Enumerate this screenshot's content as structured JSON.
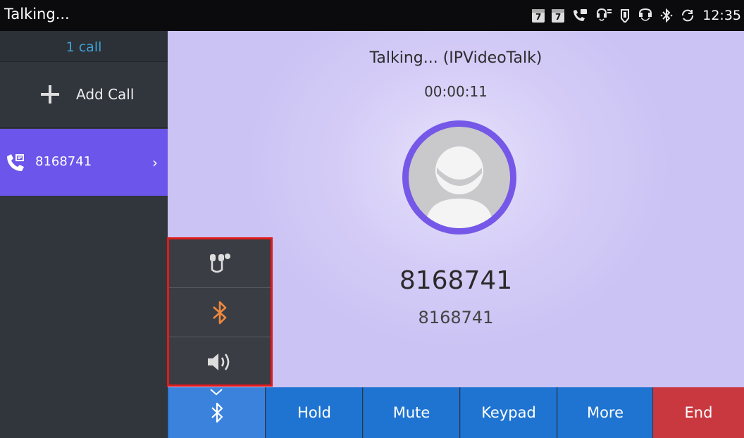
{
  "status_bar": {
    "title": "Talking...",
    "calendar_day_1": "7",
    "calendar_day_2": "7",
    "time": "12:35",
    "icons": [
      "calendar-icon",
      "calendar-icon",
      "phone-message-icon",
      "headset-signal-icon",
      "usb-icon",
      "headset-icon",
      "bluetooth-icon",
      "sync-icon"
    ]
  },
  "sidebar": {
    "call_count": "1 call",
    "add_call_label": "Add Call",
    "call_item": {
      "number": "8168741",
      "icon": "phone-in-call-icon"
    }
  },
  "call": {
    "status": "Talking... (IPVideoTalk)",
    "duration": "00:00:11",
    "remote_number": "8168741",
    "remote_name": "8168741"
  },
  "audio_popup": {
    "options": [
      "headset-icon",
      "bluetooth-icon",
      "speaker-icon"
    ],
    "selected": "bluetooth-icon"
  },
  "toolbar": {
    "audio_button_icon": "bluetooth-icon",
    "hold_label": "Hold",
    "mute_label": "Mute",
    "keypad_label": "Keypad",
    "more_label": "More",
    "end_label": "End"
  },
  "colors": {
    "accent": "#6b55ea",
    "button": "#1f74d1",
    "end": "#c9373f",
    "bluetooth_active": "#f0883e",
    "highlight": "#e11b1b"
  }
}
